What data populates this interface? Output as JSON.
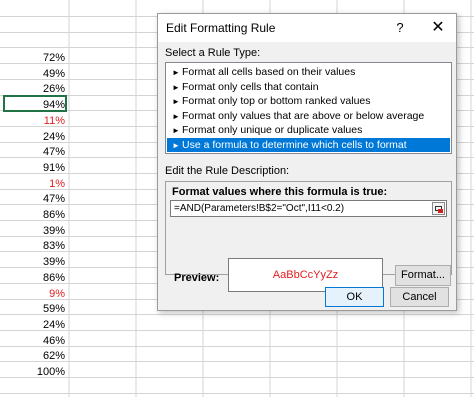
{
  "spreadsheet": {
    "cells": [
      {
        "value": "72%",
        "color": "#000000"
      },
      {
        "value": "49%",
        "color": "#000000"
      },
      {
        "value": "26%",
        "color": "#000000"
      },
      {
        "value": "94%",
        "color": "#000000"
      },
      {
        "value": "11%",
        "color": "#e02020"
      },
      {
        "value": "24%",
        "color": "#000000"
      },
      {
        "value": "47%",
        "color": "#000000"
      },
      {
        "value": "91%",
        "color": "#000000"
      },
      {
        "value": "1%",
        "color": "#e02020"
      },
      {
        "value": "47%",
        "color": "#000000"
      },
      {
        "value": "86%",
        "color": "#000000"
      },
      {
        "value": "39%",
        "color": "#000000"
      },
      {
        "value": "83%",
        "color": "#000000"
      },
      {
        "value": "39%",
        "color": "#000000"
      },
      {
        "value": "86%",
        "color": "#000000"
      },
      {
        "value": "9%",
        "color": "#e02020"
      },
      {
        "value": "59%",
        "color": "#000000"
      },
      {
        "value": "24%",
        "color": "#000000"
      },
      {
        "value": "46%",
        "color": "#000000"
      },
      {
        "value": "62%",
        "color": "#000000"
      },
      {
        "value": "100%",
        "color": "#000000"
      }
    ]
  },
  "dialog": {
    "title": "Edit Formatting Rule",
    "help": "?",
    "close": "✕",
    "rule_type_label": "Select a Rule Type:",
    "rule_types": [
      "Format all cells based on their values",
      "Format only cells that contain",
      "Format only top or bottom ranked values",
      "Format only values that are above or below average",
      "Format only unique or duplicate values",
      "Use a formula to determine which cells to format"
    ],
    "selected_rule_index": 5,
    "description_label": "Edit the Rule Description:",
    "formula_label": "Format values where this formula is true:",
    "formula_value": "=AND(Parameters!B$2=\"Oct\",I11<0.2)",
    "preview_label": "Preview:",
    "preview_text": "AaBbCcYyZz",
    "format_button": "Format...",
    "ok_button": "OK",
    "cancel_button": "Cancel"
  },
  "colors": {
    "accent": "#0078d7",
    "preview_text": "#e02020",
    "selection_border": "#217346"
  }
}
